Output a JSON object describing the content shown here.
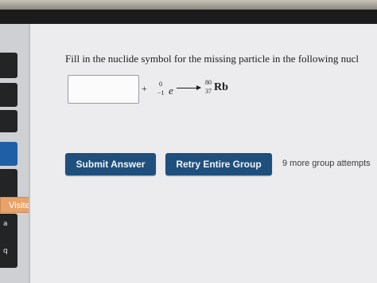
{
  "question": {
    "text": "Fill in the nuclide symbol for the missing particle in the following nucl"
  },
  "equation": {
    "answer_value": "",
    "plus": "+",
    "electron": {
      "mass": "0",
      "atomic": "−1",
      "symbol": "e"
    },
    "product": {
      "mass": "80",
      "atomic": "37",
      "symbol": "Rb"
    }
  },
  "buttons": {
    "submit_label": "Submit Answer",
    "retry_label": "Retry Entire Group"
  },
  "attempts_text": "9 more group attempts",
  "sidebar": {
    "visited_label": "Visited",
    "glyphs": [
      "a",
      "q"
    ]
  },
  "colors": {
    "button_bg": "#1f4f7c",
    "visited_bg": "#e8a36b",
    "panel_bg": "#ececee"
  }
}
